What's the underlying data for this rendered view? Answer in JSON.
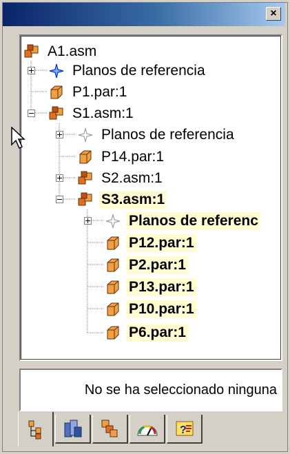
{
  "window": {
    "close_label": "×"
  },
  "tree": {
    "nodes": [
      {
        "label": "A1.asm",
        "icon": "assembly-icon",
        "bold": false
      },
      {
        "label": "Planos de referencia",
        "icon": "reference-planes-icon",
        "bold": false
      },
      {
        "label": "P1.par:1",
        "icon": "part-icon",
        "bold": false
      },
      {
        "label": "S1.asm:1",
        "icon": "assembly-icon",
        "bold": false
      },
      {
        "label": "Planos de referencia",
        "icon": "reference-planes-gray-icon",
        "bold": false
      },
      {
        "label": "P14.par:1",
        "icon": "part-icon",
        "bold": false
      },
      {
        "label": "S2.asm:1",
        "icon": "assembly-icon",
        "bold": false
      },
      {
        "label": "S3.asm:1",
        "icon": "assembly-icon",
        "bold": true
      },
      {
        "label": "Planos de referenc",
        "icon": "reference-planes-gray-icon",
        "bold": true
      },
      {
        "label": "P12.par:1",
        "icon": "part-icon",
        "bold": true
      },
      {
        "label": "P2.par:1",
        "icon": "part-icon",
        "bold": true
      },
      {
        "label": "P13.par:1",
        "icon": "part-icon",
        "bold": true
      },
      {
        "label": "P10.par:1",
        "icon": "part-icon",
        "bold": true
      },
      {
        "label": "P6.par:1",
        "icon": "part-icon",
        "bold": true
      }
    ]
  },
  "status": {
    "text": "No se ha seleccionado ninguna"
  },
  "tabs": [
    {
      "icon": "feature-tree-icon",
      "active": true
    },
    {
      "icon": "library-icon",
      "active": false
    },
    {
      "icon": "layers-icon",
      "active": false
    },
    {
      "icon": "gauge-icon",
      "active": false
    },
    {
      "icon": "help-icon",
      "active": false
    }
  ],
  "colors": {
    "titlebar_start": "#0a246a",
    "titlebar_end": "#a6caf0",
    "selection_highlight": "#fffcd2",
    "panel_face": "#d4d0c8"
  }
}
